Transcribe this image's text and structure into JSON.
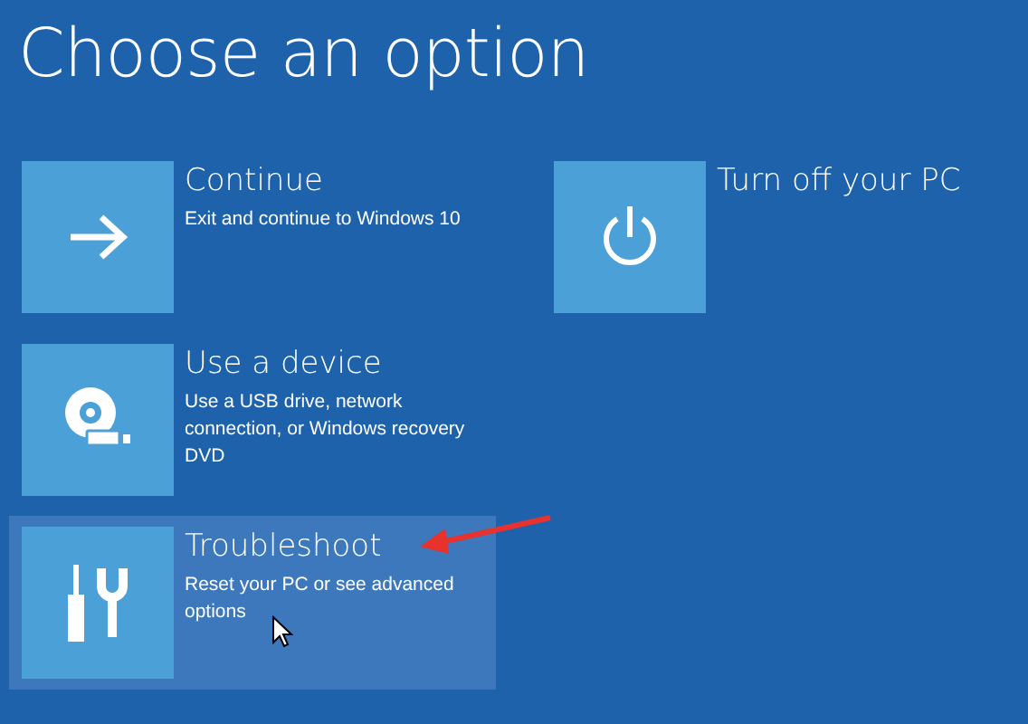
{
  "title": "Choose an option",
  "columns": [
    [
      {
        "kind": "arrow",
        "title": "Continue",
        "description": "Exit and continue to Windows 10",
        "selected": false
      },
      {
        "kind": "disc",
        "title": "Use a device",
        "description": "Use a USB drive, network connection, or Windows recovery DVD",
        "selected": false
      },
      {
        "kind": "tools",
        "title": "Troubleshoot",
        "description": "Reset your PC or see advanced options",
        "selected": true
      }
    ],
    [
      {
        "kind": "power",
        "title": "Turn off your PC",
        "selected": false
      }
    ]
  ]
}
